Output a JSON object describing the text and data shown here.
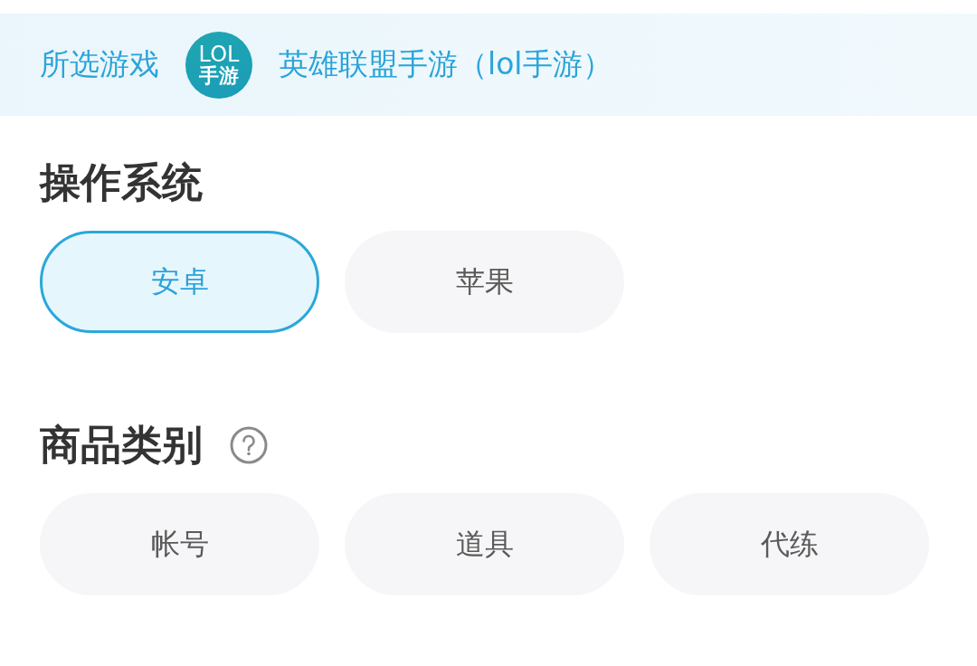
{
  "header": {
    "label": "所选游戏",
    "game_logo": {
      "lines": [
        "LOL",
        "手游"
      ]
    },
    "game_name": "英雄联盟手游（lol手游）"
  },
  "sections": [
    {
      "title": "操作系统",
      "help": false,
      "options": [
        {
          "label": "安卓",
          "selected": true
        },
        {
          "label": "苹果",
          "selected": false
        }
      ]
    },
    {
      "title": "商品类别",
      "help": true,
      "options": [
        {
          "label": "帐号",
          "selected": false
        },
        {
          "label": "道具",
          "selected": false
        },
        {
          "label": "代练",
          "selected": false
        }
      ]
    }
  ]
}
